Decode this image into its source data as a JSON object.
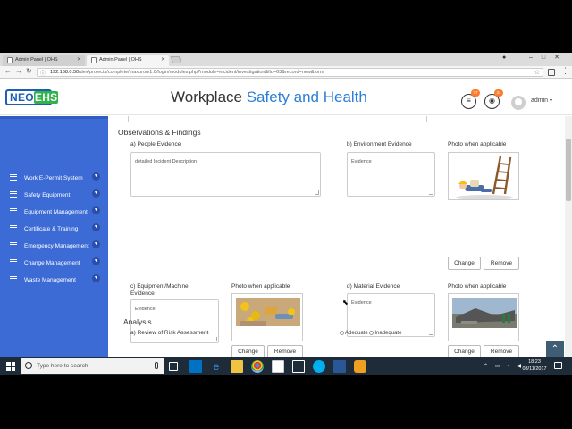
{
  "browser": {
    "tabs": [
      {
        "label": "Admin Panel | OHS"
      },
      {
        "label": "Admin Panel | OHS"
      }
    ],
    "url_host": "192.168.0.50",
    "url_path": "/dev/projects/complete/maxpro/v1.0/login/modules.php?module=incident/investigation&fid=63&record=new&form"
  },
  "header": {
    "logo_neo": "NEO",
    "logo_ehs": "EHS",
    "title_part1": "Workplace ",
    "title_part2": "Safety and Health",
    "badge_1": "77",
    "badge_2": "34",
    "user": "admin"
  },
  "sidebar": {
    "items": [
      {
        "label": "Work E-Permit System"
      },
      {
        "label": "Safety Equipment"
      },
      {
        "label": "Equipment Management"
      },
      {
        "label": "Certificate & Training"
      },
      {
        "label": "Emergency Management"
      },
      {
        "label": "Change Management"
      },
      {
        "label": "Waste Management"
      }
    ]
  },
  "form": {
    "section_title": "Observations & Findings",
    "people_label": "a) People Evidence",
    "people_value": "detailed Incident Description",
    "env_label": "b) Environment Evidence",
    "env_value": "Evidence",
    "equip_label": "c) Equipment/Machine Evidence",
    "equip_value": "Evidence",
    "material_label": "d) Material Evidence",
    "material_value": "Evidence",
    "photo_label": "Photo when applicable",
    "change_label": "Change",
    "remove_label": "Remove",
    "analysis_title": "Analysis",
    "risk_label": "a) Review of Risk Assessment",
    "radio_adequate": "Adequate",
    "radio_inadequate": "Inadequate"
  },
  "taskbar": {
    "search_placeholder": "Type here to search",
    "time": "18:23",
    "date": "08/11/2017"
  }
}
